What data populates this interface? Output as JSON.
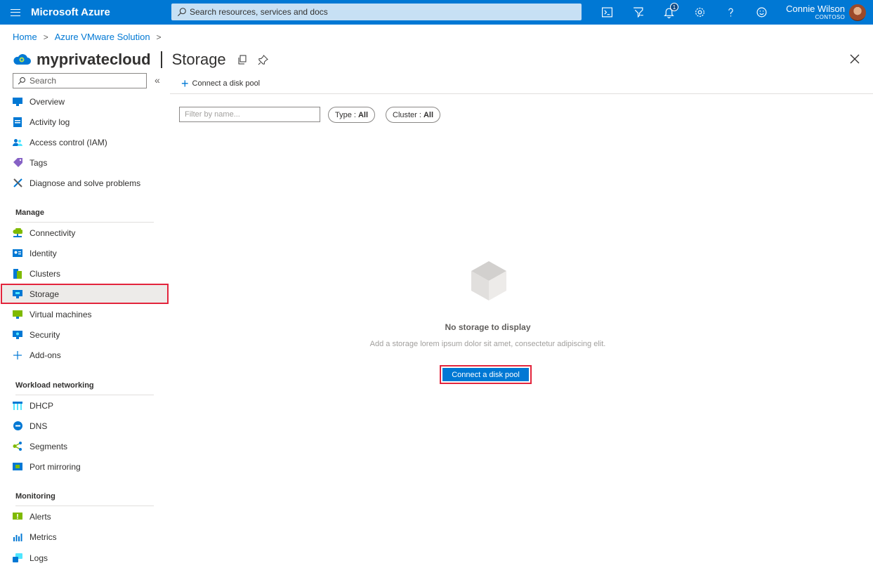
{
  "topbar": {
    "brand": "Microsoft Azure",
    "search_placeholder": "Search resources, services and docs",
    "notification_count": "1",
    "user_name": "Connie Wilson",
    "user_org": "CONTOSO"
  },
  "breadcrumb": {
    "items": [
      "Home",
      "Azure VMware Solution"
    ]
  },
  "title": {
    "resource": "myprivatecloud",
    "page": "Storage"
  },
  "sidebar": {
    "search_placeholder": "Search",
    "top_items": [
      "Overview",
      "Activity log",
      "Access control (IAM)",
      "Tags",
      "Diagnose and solve problems"
    ],
    "sections": [
      {
        "heading": "Manage",
        "items": [
          "Connectivity",
          "Identity",
          "Clusters",
          "Storage",
          "Virtual machines",
          "Security",
          "Add-ons"
        ]
      },
      {
        "heading": "Workload networking",
        "items": [
          "DHCP",
          "DNS",
          "Segments",
          "Port mirroring"
        ]
      },
      {
        "heading": "Monitoring",
        "items": [
          "Alerts",
          "Metrics",
          "Logs"
        ]
      }
    ],
    "selected": "Storage"
  },
  "toolbar": {
    "connect_label": "Connect a disk pool"
  },
  "filters": {
    "name_placeholder": "Filter by name...",
    "type_label": "Type :",
    "type_value": "All",
    "cluster_label": "Cluster :",
    "cluster_value": "All"
  },
  "empty_state": {
    "title": "No storage to display",
    "description": "Add a storage lorem ipsum dolor sit amet, consectetur adipiscing elit.",
    "button": "Connect a disk pool"
  },
  "colors": {
    "accent": "#0078d4",
    "highlight": "#e3243c",
    "searchbar": "#c7e0f4"
  }
}
